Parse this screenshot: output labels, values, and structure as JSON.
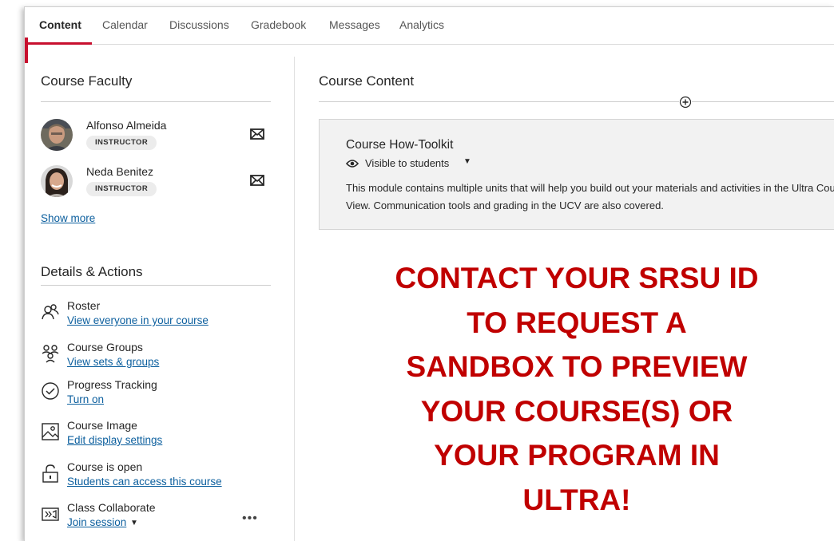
{
  "tabs": [
    {
      "label": "Content"
    },
    {
      "label": "Calendar"
    },
    {
      "label": "Discussions"
    },
    {
      "label": "Gradebook"
    },
    {
      "label": "Messages"
    },
    {
      "label": "Analytics"
    }
  ],
  "active_tab": "Content",
  "accent_color": "#c8102e",
  "link_color": "#0c5f9e",
  "faculty": {
    "title": "Course Faculty",
    "members": [
      {
        "name": "Alfonso Almeida",
        "role": "INSTRUCTOR"
      },
      {
        "name": "Neda Benitez",
        "role": "INSTRUCTOR"
      }
    ],
    "show_more": "Show more"
  },
  "details": {
    "title": "Details & Actions",
    "actions": [
      {
        "icon": "roster-icon",
        "title": "Roster",
        "link": "View everyone in your course"
      },
      {
        "icon": "groups-icon",
        "title": "Course Groups",
        "link": "View sets & groups"
      },
      {
        "icon": "progress-check-icon",
        "title": "Progress Tracking",
        "link": "Turn on"
      },
      {
        "icon": "image-icon",
        "title": "Course Image",
        "link": "Edit display settings"
      },
      {
        "icon": "unlock-icon",
        "title": "Course is open",
        "link": "Students can access this course"
      },
      {
        "icon": "collaborate-icon",
        "title": "Class Collaborate",
        "link": "Join session"
      }
    ]
  },
  "content": {
    "title": "Course Content",
    "module": {
      "title": "Course How-Toolkit",
      "visibility": "Visible to students",
      "description": "This module contains multiple units that will help you build out your materials and activities in the Ultra Course View. Communication tools and grading in the UCV are also covered."
    }
  },
  "promo": {
    "lines": [
      "CONTACT YOUR SRSU ID",
      "TO REQUEST A",
      "SANDBOX TO PREVIEW",
      "YOUR COURSE(S) OR",
      "YOUR PROGRAM IN",
      "ULTRA!"
    ],
    "color": "#c00000"
  }
}
